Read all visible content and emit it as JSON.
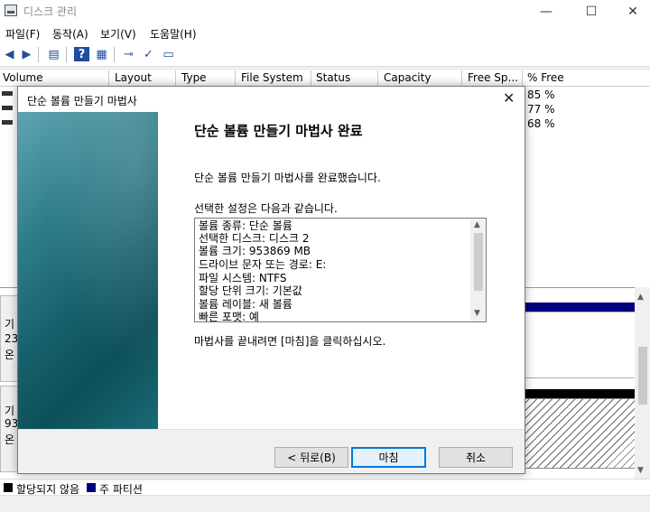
{
  "window": {
    "title": "디스크 관리",
    "minimize": "—",
    "maximize": "☐",
    "close": "✕"
  },
  "menu": [
    "파일(F)",
    "동작(A)",
    "보기(V)",
    "도움말(H)"
  ],
  "toolbar_icons": [
    "back-arrow-icon",
    "forward-arrow-icon",
    "console-tree-icon",
    "help-icon",
    "properties-icon",
    "connect-icon",
    "check-icon",
    "settings-icon"
  ],
  "volume_columns": [
    "Volume",
    "Layout",
    "Type",
    "File System",
    "Status",
    "Capacity",
    "Free Sp...",
    "% Free"
  ],
  "volume_rows": [
    {
      "pct_free": "85 %"
    },
    {
      "pct_free": "77 %"
    },
    {
      "pct_free": "68 %"
    }
  ],
  "disks": [
    {
      "line1": "기",
      "line2": "23",
      "line3": "온"
    },
    {
      "line1": "기",
      "line2": "93",
      "line3": "온"
    }
  ],
  "legend": [
    {
      "label": "할당되지 않음",
      "color": "#000000"
    },
    {
      "label": "주 파티션",
      "color": "#000080"
    }
  ],
  "dialog": {
    "title": "단순 볼륨 만들기 마법사",
    "close": "✕",
    "heading": "단순 볼륨 만들기 마법사 완료",
    "completed_text": "단순 볼륨 만들기 마법사를 완료했습니다.",
    "settings_intro": "선택한 설정은 다음과 같습니다.",
    "summary": [
      "볼륨 종류: 단순 볼륨",
      "선택한 디스크: 디스크 2",
      "볼륨 크기: 953869 MB",
      "드라이브 문자 또는 경로: E:",
      "파일 시스템: NTFS",
      "할당 단위 크기: 기본값",
      "볼륨 레이블: 새 볼륨",
      "빠른 포맷: 예"
    ],
    "finish_instruction": "마법사를 끝내려면 [마침]을 클릭하십시오.",
    "buttons": {
      "back": "< 뒤로(B)",
      "finish": "마침",
      "cancel": "취소"
    }
  }
}
